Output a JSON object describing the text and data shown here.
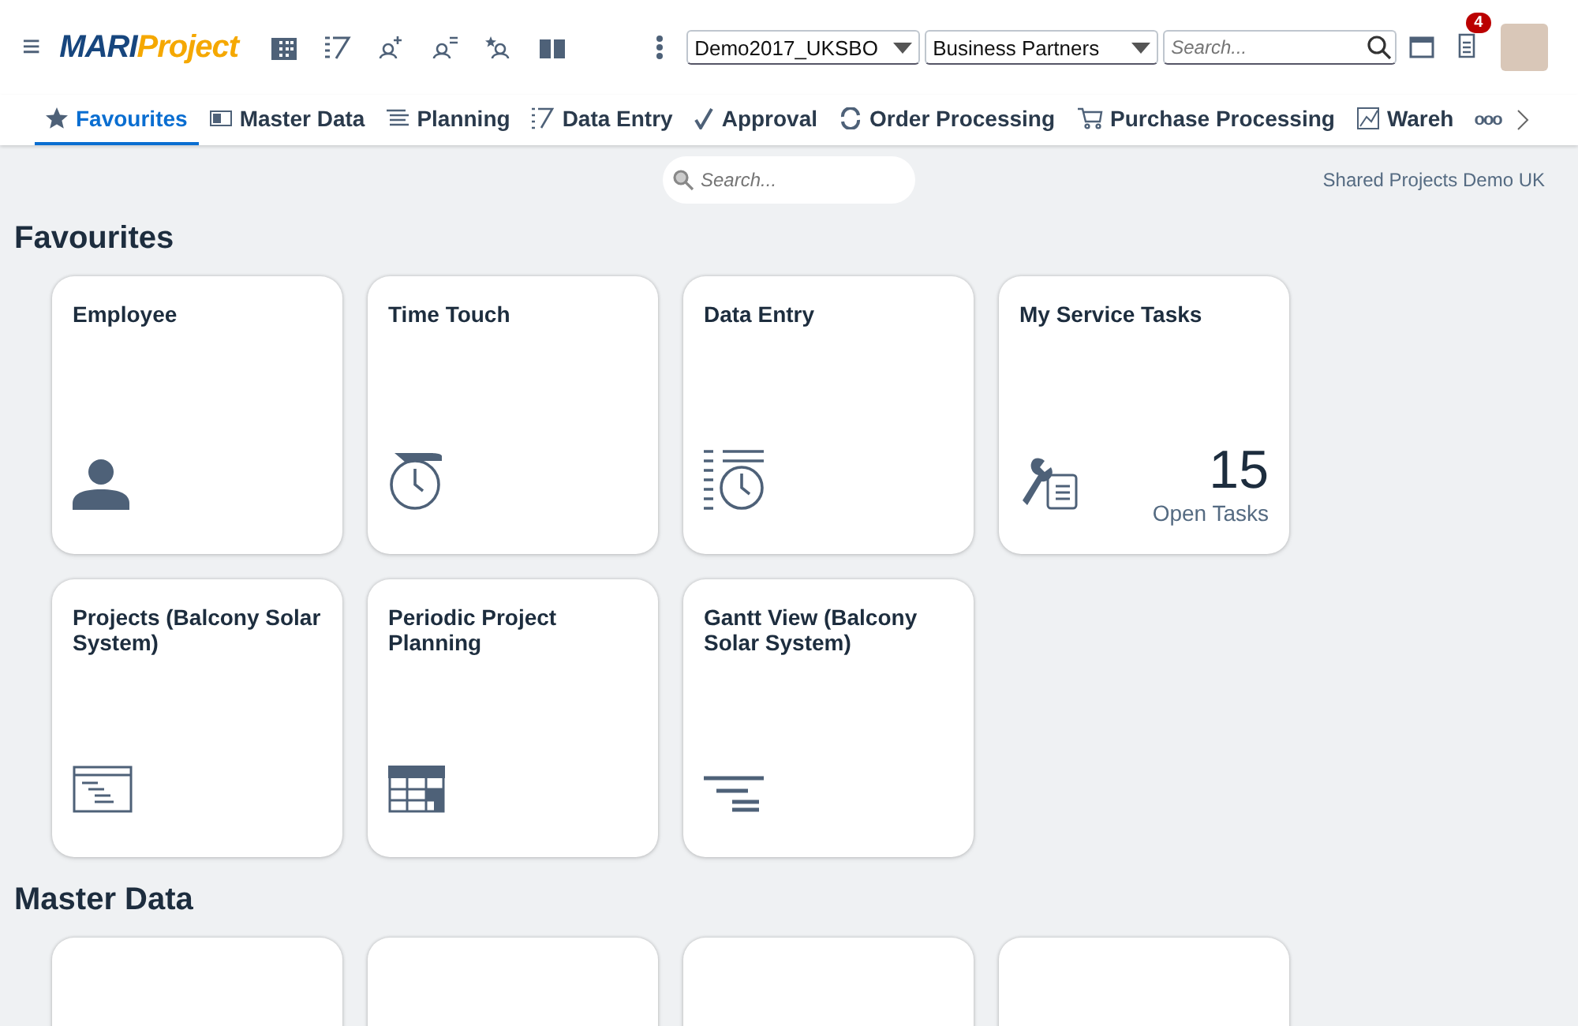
{
  "header": {
    "menu_glyph": "≡",
    "logo": {
      "part_1": "MARI",
      "part_2": "Project"
    },
    "company": "Demo2017_UKSBO",
    "object_type": "Business Partners",
    "search": {
      "placeholder": "Search..."
    },
    "notification_count": "4"
  },
  "tabs": [
    {
      "label": "Favourites",
      "selected": true
    },
    {
      "label": "Master Data",
      "selected": false
    },
    {
      "label": "Planning",
      "selected": false
    },
    {
      "label": "Data Entry",
      "selected": false
    },
    {
      "label": "Approval",
      "selected": false
    },
    {
      "label": "Order Processing",
      "selected": false
    },
    {
      "label": "Purchase Processing",
      "selected": false
    },
    {
      "label": "Wareh",
      "selected": false
    }
  ],
  "overflow_glyph": "ooo",
  "tile_search": {
    "placeholder": "Search..."
  },
  "project_label": "Shared Projects Demo UK",
  "sections": [
    {
      "title": "Favourites",
      "tiles": [
        {
          "kind": "person",
          "title": "Employee"
        },
        {
          "kind": "timer",
          "title": "Time Touch"
        },
        {
          "kind": "entry",
          "title": "Data Entry"
        },
        {
          "kind": "kpi",
          "title": "My Service Tasks",
          "value": "15",
          "unit": "Open Tasks"
        },
        {
          "kind": "project",
          "title": "Projects (Balcony Solar System)"
        },
        {
          "kind": "planning",
          "title": "Periodic Project Planning"
        },
        {
          "kind": "gantt",
          "title": "Gantt View (Balcony Solar System)"
        }
      ]
    },
    {
      "title": "Master Data",
      "tiles": [
        {
          "kind": "blank"
        },
        {
          "kind": "blank"
        },
        {
          "kind": "blank"
        },
        {
          "kind": "blank"
        }
      ]
    }
  ]
}
